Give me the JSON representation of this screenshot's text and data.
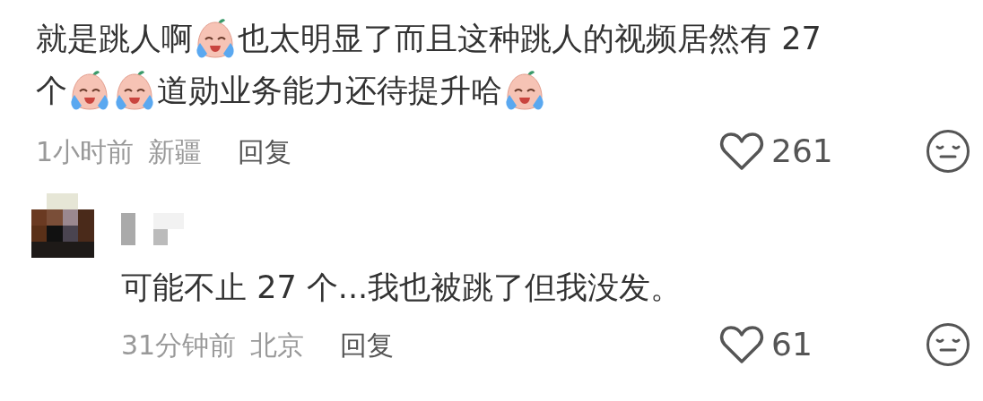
{
  "comment": {
    "lines": [
      [
        {
          "kind": "text",
          "text": "就是跳人啊"
        },
        {
          "kind": "emoji"
        },
        {
          "kind": "text",
          "text": "也太明显了而且这种跳人的视频居然有 27"
        }
      ],
      [
        {
          "kind": "text",
          "text": "个"
        },
        {
          "kind": "emoji"
        },
        {
          "kind": "emoji"
        },
        {
          "kind": "text",
          "text": "道勋业务能力还待提升哈"
        },
        {
          "kind": "emoji"
        }
      ]
    ],
    "time": "1小时前",
    "location": "新疆",
    "reply": "回复",
    "likes": "261",
    "liked": false
  },
  "replies": [
    {
      "text": "可能不止 27 个...我也被跳了但我没发。",
      "time": "31分钟前",
      "location": "北京",
      "reply": "回复",
      "likes": "61",
      "liked": false
    }
  ]
}
